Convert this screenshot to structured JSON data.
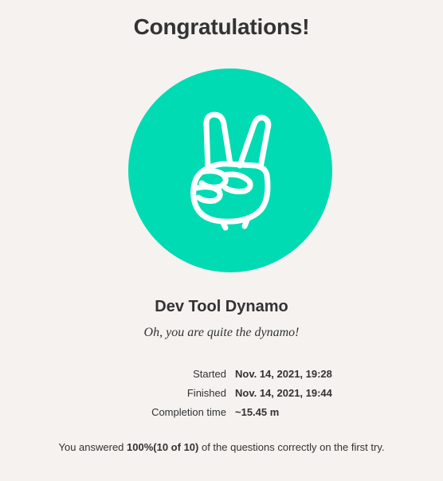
{
  "heading": "Congratulations!",
  "badge": {
    "icon": "victory-hand-icon",
    "color": "#00dbb4",
    "name": "Dev Tool Dynamo",
    "description": "Oh, you are quite the dynamo!"
  },
  "stats": {
    "started_label": "Started",
    "started_value": "Nov. 14, 2021, 19:28",
    "finished_label": "Finished",
    "finished_value": "Nov. 14, 2021, 19:44",
    "completion_label": "Completion time",
    "completion_value": "~15.45 m"
  },
  "summary": {
    "prefix": "You answered ",
    "score": "100%",
    "count": "(10 of 10)",
    "suffix": " of the questions correctly on the first try."
  }
}
